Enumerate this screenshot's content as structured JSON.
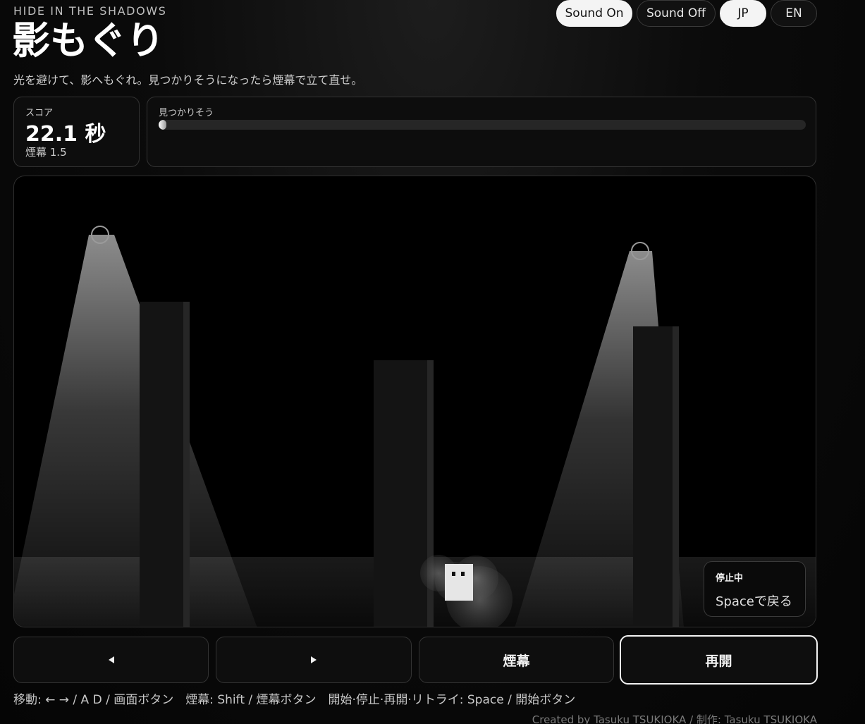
{
  "header": {
    "eyebrow": "HIDE IN THE SHADOWS",
    "title": "影もぐり",
    "subtitle": "光を避けて、影へもぐれ。見つかりそうになったら煙幕で立て直せ。"
  },
  "top_buttons": {
    "sound_on": "Sound On",
    "sound_off": "Sound Off",
    "lang_jp": "JP",
    "lang_en": "EN",
    "active_sound": "sound_on",
    "active_lang": "jp"
  },
  "score": {
    "label": "スコア",
    "value": "22.1 秒",
    "smoke": "煙幕 1.5"
  },
  "detection": {
    "label": "見つかりそう",
    "level": 0.01
  },
  "status": {
    "title": "停止中",
    "hint": "Spaceで戻る"
  },
  "controls": {
    "left_icon": "triangle-left-icon",
    "right_icon": "triangle-right-icon",
    "smoke_label": "煙幕",
    "resume_label": "再開"
  },
  "help_text": "移動: ← → / A D / 画面ボタン　煙幕: Shift / 煙幕ボタン　開始·停止·再開·リトライ: Space / 開始ボタン",
  "credit": "Created by Tasuku TSUKIOKA / 制作: Tasuku TSUKIOKA",
  "colors": {
    "background": "#050505",
    "panel": "#0d0d0d",
    "border": "#333333",
    "accent": "#f4f4f4"
  }
}
